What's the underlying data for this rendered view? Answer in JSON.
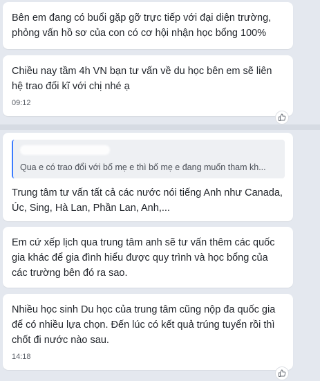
{
  "chat": {
    "messages": [
      {
        "text": "Bên em đang có buổi gặp gỡ trực tiếp với đại diện trường, phỏng vấn hồ sơ của con có cơ hội nhận học bổng 100%"
      },
      {
        "text": "Chiều nay tầm 4h VN bạn tư vấn về du học bên em sẽ liên hệ trao đổi kĩ với chị nhé ạ",
        "time": "09:12"
      },
      {
        "quote": "Qua e có trao đổi với bố mẹ e thì bố mẹ e đang muốn tham kh...",
        "text": "Trung tâm tư vấn tất cả các nước nói tiếng Anh như Canada, Úc, Sing, Hà Lan, Phần Lan, Anh,..."
      },
      {
        "text": "Em cứ xếp lịch qua trung tâm anh sẽ tư vấn thêm các quốc gia khác để gia đình hiểu được quy trình và học bổng của các trường bên đó ra sao."
      },
      {
        "text": "Nhiều học sinh Du học của trung tâm cũng nộp đa quốc gia để có nhiều lựa chọn. Đến lúc có kết quả trúng tuyển rồi thì chốt đi nước nào sau.",
        "time": "14:18"
      }
    ]
  },
  "icons": {
    "reaction": "thumbs-up-icon"
  },
  "colors": {
    "background": "#e4e8ef",
    "bubble": "#ffffff",
    "quote_bar": "#3b7bff"
  }
}
